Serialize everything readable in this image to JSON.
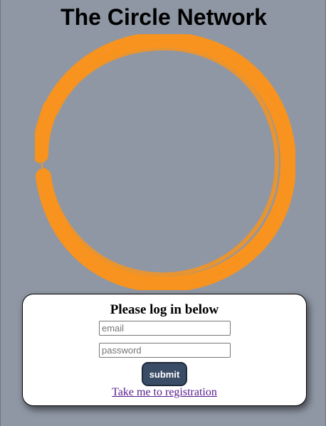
{
  "header": {
    "title": "The Circle Network"
  },
  "logo": {
    "icon": "orange-brush-circle-icon",
    "color": "#f7931e"
  },
  "login": {
    "heading": "Please log in below",
    "email_placeholder": "email",
    "password_placeholder": "password",
    "submit_label": "submit",
    "registration_link": "Take me to registration"
  },
  "colors": {
    "background": "#8f97a5",
    "button": "#3a4c66",
    "link_visited": "#551a8b"
  }
}
